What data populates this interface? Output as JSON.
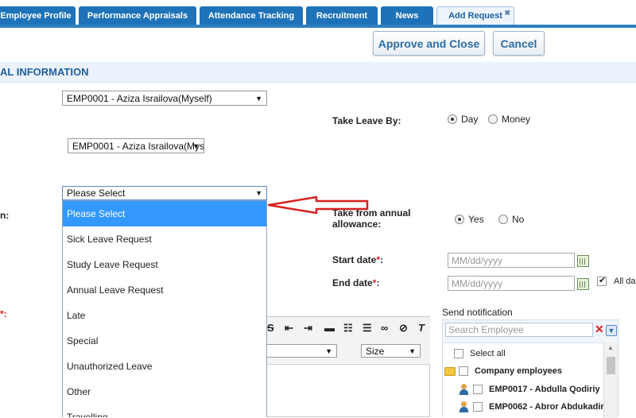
{
  "tabs": [
    {
      "label": "Employee Profile"
    },
    {
      "label": "Performance Appraisals"
    },
    {
      "label": "Attendance Tracking"
    },
    {
      "label": "Recruitment"
    },
    {
      "label": "News"
    },
    {
      "label": "Add Request",
      "active": true
    }
  ],
  "toolbar": {
    "approve_label": "Approve and Close",
    "cancel_label": "Cancel"
  },
  "section": {
    "title": "AL INFORMATION"
  },
  "form": {
    "employee_select": "EMP0001 - Aziza Israilova(Myself)",
    "employee_select2": "EMP0001 - Aziza Israilova(Myse",
    "request_type_select": "Please Select",
    "label_fragment_reason": "n:",
    "label_fragment_desc": "*:",
    "take_leave_by_label": "Take Leave By:",
    "take_leave_by_options": [
      "Day",
      "Money"
    ],
    "take_from_label_1": "Take from annual",
    "take_from_label_2": "allowance:",
    "take_from_options": [
      "Yes",
      "No"
    ],
    "start_date_label": "Start date",
    "end_date_label": "End date",
    "date_placeholder": "MM/dd/yyyy",
    "all_day_label": "All da"
  },
  "dropdown": {
    "options": [
      "Please Select",
      "Sick Leave Request",
      "Study Leave Request",
      "Annual Leave Request",
      "Late",
      "Special",
      "Unauthorized Leave",
      "Other",
      "Travelling"
    ]
  },
  "editor": {
    "size_select": "Size"
  },
  "notification": {
    "title": "Send notification",
    "search_placeholder": "Search Employee",
    "select_all": "Select all",
    "group": "Company employees",
    "employees": [
      "EMP0017 - Abdulla Qodiriy",
      "EMP0062 - Abror Abdukadir"
    ]
  },
  "colors": {
    "tab": "#1e73b8",
    "accent": "#2e6da4",
    "selected": "#3399ff",
    "arrow": "#d62020"
  }
}
